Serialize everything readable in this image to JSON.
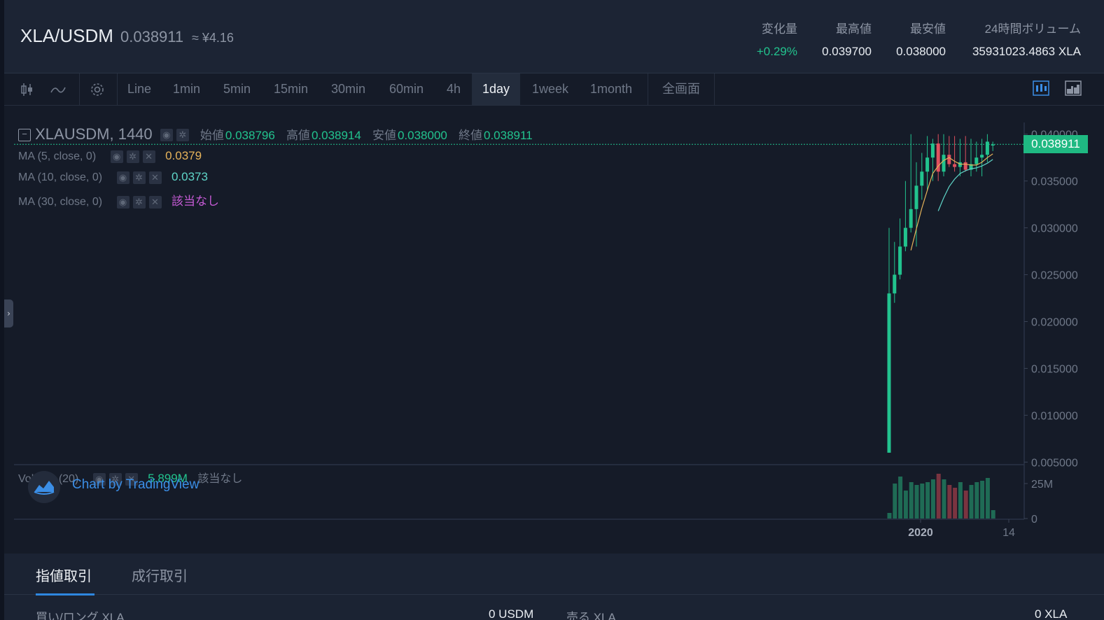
{
  "header": {
    "pair": "XLA/USDM",
    "last_price": "0.038911",
    "yen_price": "≈ ¥4.16",
    "stats": [
      {
        "label": "変化量",
        "value": "+0.29%",
        "positive": true
      },
      {
        "label": "最高値",
        "value": "0.039700",
        "positive": false
      },
      {
        "label": "最安値",
        "value": "0.038000",
        "positive": false
      },
      {
        "label": "24時間ボリューム",
        "value": "35931023.4863 XLA",
        "positive": false
      }
    ]
  },
  "toolbar": {
    "icons": [
      "candlestick-type-icon",
      "indicator-wave-icon",
      "settings-gear-icon"
    ],
    "intervals": [
      "Line",
      "1min",
      "5min",
      "15min",
      "30min",
      "60min",
      "4h",
      "1day",
      "1week",
      "1month"
    ],
    "active_interval": "1day",
    "fullscreen_label": "全画面"
  },
  "chart": {
    "symbol": "XLAUSDM, 1440",
    "ohlc": [
      {
        "label": "始値",
        "value": "0.038796"
      },
      {
        "label": "高値",
        "value": "0.038914"
      },
      {
        "label": "安値",
        "value": "0.038000"
      },
      {
        "label": "終値",
        "value": "0.038911"
      }
    ],
    "ma": [
      {
        "label": "MA (5, close, 0)",
        "value": "0.0379",
        "color": "#e6b35a"
      },
      {
        "label": "MA (10, close, 0)",
        "value": "0.0373",
        "color": "#5fd5c8"
      },
      {
        "label": "MA (30, close, 0)",
        "value": "該当なし",
        "color": "#c65bd6"
      }
    ],
    "volume": {
      "label": "Volume (20)",
      "value": "5.899M",
      "ma_value": "該当なし"
    },
    "watermark": "Chart by TradingView",
    "current_price_tag": "0.038911",
    "colors": {
      "up": "#22c38e",
      "down": "#e0505e",
      "grid": "#2a3345"
    }
  },
  "chart_data": {
    "type": "candlestick",
    "y_ticks": [
      "0.040000",
      "0.035000",
      "0.030000",
      "0.025000",
      "0.020000",
      "0.015000",
      "0.010000",
      "0.005000"
    ],
    "ylim": [
      0.0048,
      0.0408
    ],
    "volume_ticks": [
      "25M",
      "0"
    ],
    "volume_ylim": [
      0,
      36
    ],
    "x_ticks": [
      "2020",
      "14"
    ],
    "current_price": 0.038911,
    "candles": [
      {
        "o": 0.006,
        "h": 0.03,
        "l": 0.006,
        "c": 0.023,
        "v": 4
      },
      {
        "o": 0.023,
        "h": 0.0285,
        "l": 0.022,
        "c": 0.025,
        "v": 25
      },
      {
        "o": 0.025,
        "h": 0.031,
        "l": 0.0245,
        "c": 0.028,
        "v": 30
      },
      {
        "o": 0.028,
        "h": 0.035,
        "l": 0.0275,
        "c": 0.03,
        "v": 20
      },
      {
        "o": 0.03,
        "h": 0.04,
        "l": 0.0295,
        "c": 0.032,
        "v": 26
      },
      {
        "o": 0.032,
        "h": 0.037,
        "l": 0.028,
        "c": 0.0345,
        "v": 24
      },
      {
        "o": 0.0345,
        "h": 0.038,
        "l": 0.033,
        "c": 0.036,
        "v": 25
      },
      {
        "o": 0.036,
        "h": 0.0398,
        "l": 0.034,
        "c": 0.0375,
        "v": 26
      },
      {
        "o": 0.0375,
        "h": 0.0395,
        "l": 0.035,
        "c": 0.039,
        "v": 28
      },
      {
        "o": 0.039,
        "h": 0.04,
        "l": 0.035,
        "c": 0.036,
        "v": 32
      },
      {
        "o": 0.036,
        "h": 0.04,
        "l": 0.0355,
        "c": 0.0378,
        "v": 28
      },
      {
        "o": 0.0378,
        "h": 0.0398,
        "l": 0.0365,
        "c": 0.0368,
        "v": 24
      },
      {
        "o": 0.0368,
        "h": 0.0398,
        "l": 0.036,
        "c": 0.0365,
        "v": 22
      },
      {
        "o": 0.0365,
        "h": 0.0395,
        "l": 0.0355,
        "c": 0.037,
        "v": 26
      },
      {
        "o": 0.037,
        "h": 0.0398,
        "l": 0.036,
        "c": 0.0362,
        "v": 20
      },
      {
        "o": 0.0362,
        "h": 0.0395,
        "l": 0.0355,
        "c": 0.0368,
        "v": 24
      },
      {
        "o": 0.0368,
        "h": 0.0392,
        "l": 0.036,
        "c": 0.0375,
        "v": 26
      },
      {
        "o": 0.0375,
        "h": 0.0395,
        "l": 0.0355,
        "c": 0.0378,
        "v": 27
      },
      {
        "o": 0.0378,
        "h": 0.04,
        "l": 0.037,
        "c": 0.0392,
        "v": 29
      },
      {
        "o": 0.0388,
        "h": 0.0392,
        "l": 0.0382,
        "c": 0.0389,
        "v": 6
      }
    ],
    "ma5": [
      null,
      null,
      null,
      null,
      0.0276,
      0.0299,
      0.0321,
      0.034,
      0.0358,
      0.0366,
      0.0372,
      0.0375,
      0.0371,
      0.0368,
      0.0368,
      0.0367,
      0.0367,
      0.037,
      0.0375,
      0.0379
    ],
    "ma10": [
      null,
      null,
      null,
      null,
      null,
      null,
      null,
      null,
      null,
      0.0318,
      0.0332,
      0.0344,
      0.0352,
      0.0358,
      0.0361,
      0.0363,
      0.0364,
      0.0366,
      0.0369,
      0.0373
    ]
  },
  "bottom": {
    "tabs": [
      "指値取引",
      "成行取引"
    ],
    "active_tab": "指値取引",
    "buy_label": "買い/ロング XLA",
    "buy_balance": "0 USDM",
    "sell_label": "売る XLA",
    "sell_balance": "0 XLA"
  }
}
